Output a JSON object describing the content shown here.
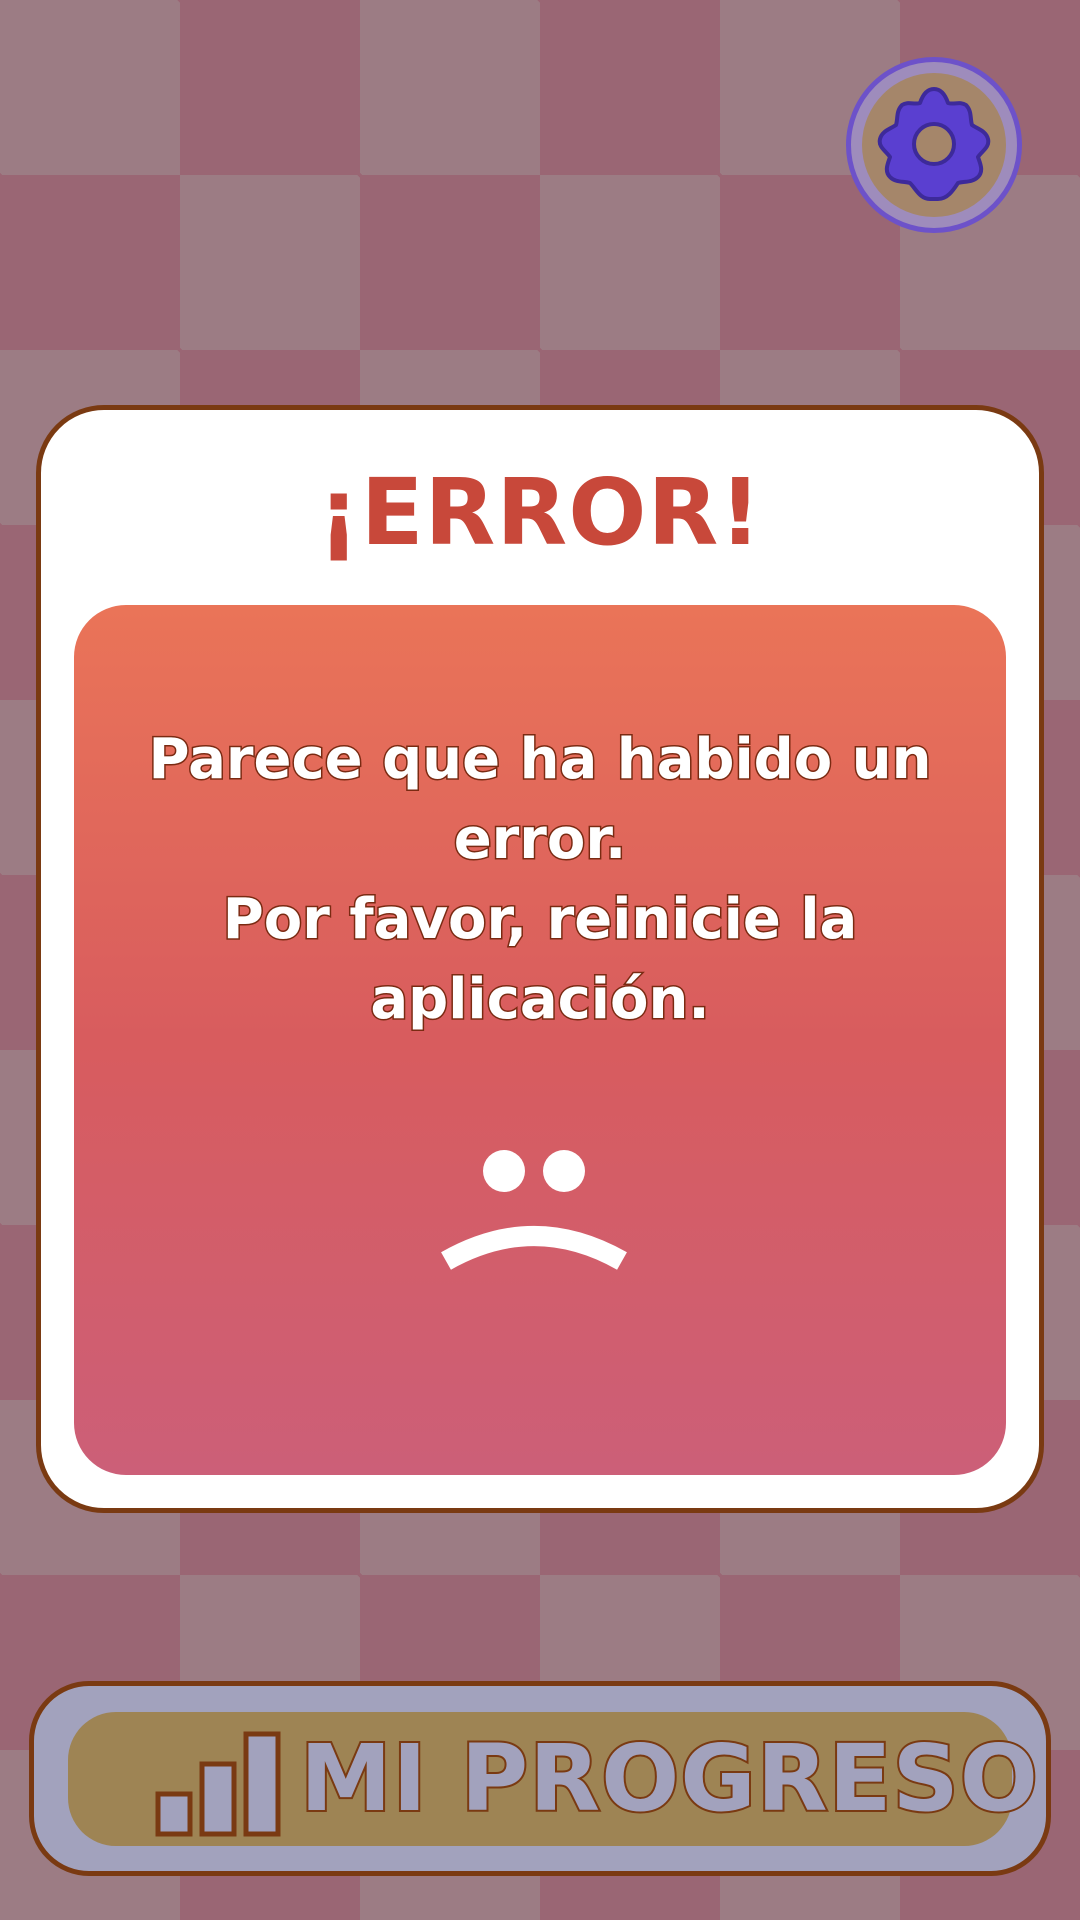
{
  "settings": {
    "icon": "gear-icon"
  },
  "dialog": {
    "title": "¡ERROR!",
    "message": "Parece que ha habido un error.\nPor favor, reinicie la aplicación.",
    "face_icon": "sad-face-icon"
  },
  "footer": {
    "progress_label": "MI PROGRESO",
    "progress_icon": "signal-bars-icon"
  },
  "colors": {
    "title": "#c8483a",
    "panel_top": "#ea7458",
    "panel_bottom": "#cc5f78",
    "outline": "#7a3a12",
    "gear": "#6d52c9",
    "button_fill": "#a2a2bd",
    "button_inner": "#9e8454"
  }
}
